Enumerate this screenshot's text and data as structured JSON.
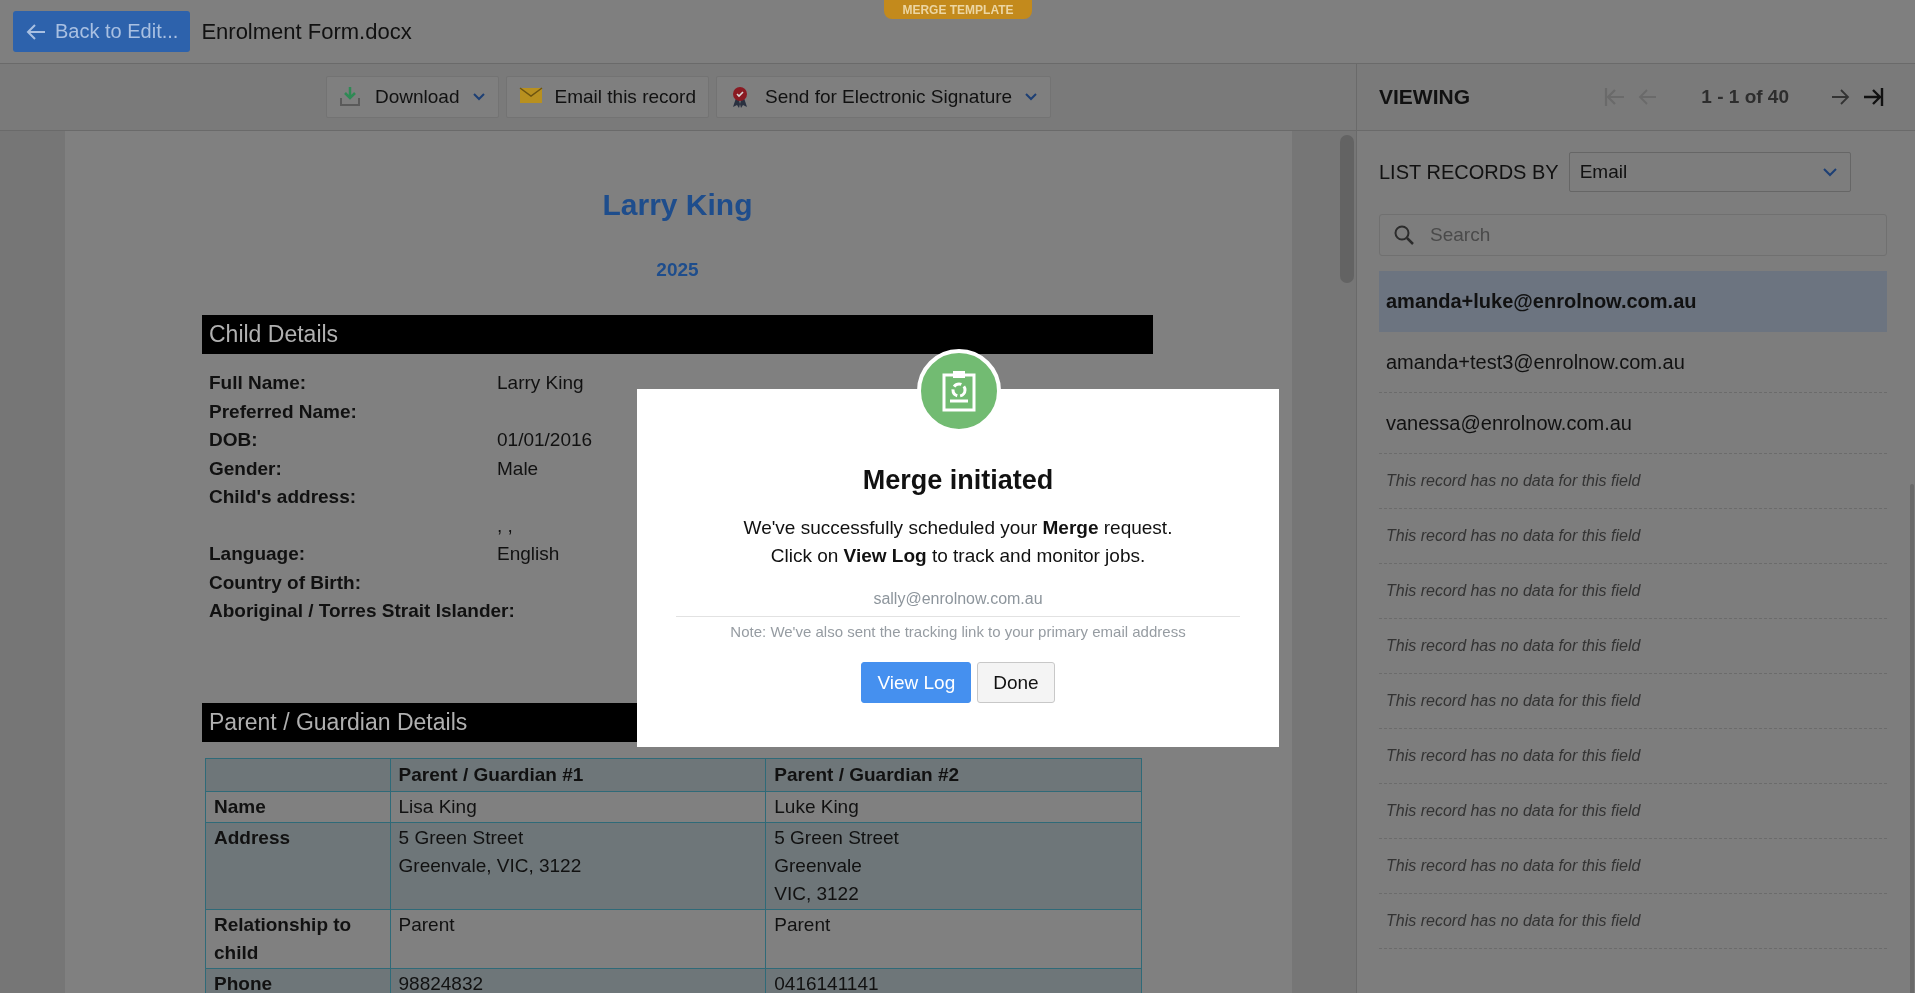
{
  "top_bar": {
    "back_button": "Back to Edit...",
    "file_name": "Enrolment Form.docx",
    "badge": "MERGE TEMPLATE"
  },
  "toolbar": [
    {
      "kind": "download",
      "label": "Download",
      "dropdown": true
    },
    {
      "kind": "email",
      "label": "Email this record",
      "dropdown": false
    },
    {
      "kind": "signature",
      "label": "Send for Electronic Signature",
      "dropdown": true
    }
  ],
  "document": {
    "title": "Larry King",
    "year": "2025",
    "sections": [
      {
        "kind": "fields",
        "heading": "Child Details",
        "fields": [
          {
            "label": "Full Name:",
            "value": "Larry King"
          },
          {
            "label": "Preferred Name:"
          },
          {
            "label": "DOB:",
            "value": "01/01/2016"
          },
          {
            "label": "Gender:",
            "value": "Male"
          },
          {
            "label": "Child's address:"
          },
          {
            "value": ", ,"
          },
          {
            "label": "Language:",
            "value": "English"
          },
          {
            "label": "Country of Birth:"
          },
          {
            "label": "Aboriginal / Torres Strait Islander:"
          }
        ]
      },
      {
        "kind": "table",
        "heading": "Parent / Guardian Details",
        "columns": [
          "Parent / Guardian #1",
          "Parent / Guardian #2"
        ],
        "rows": [
          {
            "label": "Name",
            "cells": [
              [
                "Lisa King"
              ],
              [
                "Luke King"
              ]
            ]
          },
          {
            "label": "Address",
            "cells": [
              [
                "5 Green Street",
                "Greenvale, VIC, 3122"
              ],
              [
                "5 Green Street",
                "Greenvale",
                "VIC, 3122"
              ]
            ]
          },
          {
            "label": "Relationship to child",
            "cells": [
              [
                "Parent"
              ],
              [
                "Parent"
              ]
            ]
          },
          {
            "label": "Phone",
            "cells": [
              [
                "98824832"
              ],
              [
                "0416141141"
              ]
            ]
          }
        ]
      }
    ]
  },
  "viewing_panel": {
    "title": "VIEWING",
    "pager": "1 - 1 of 40",
    "nav": [
      {
        "kind": "first",
        "disabled": true
      },
      {
        "kind": "prev",
        "disabled": true
      },
      {
        "kind": "next",
        "disabled": false
      },
      {
        "kind": "last",
        "disabled": false
      }
    ],
    "list_by": {
      "label": "LIST RECORDS BY",
      "value": "Email"
    },
    "search": {
      "placeholder": "Search"
    },
    "records": [
      {
        "kind": "value",
        "text": "amanda+luke@enrolnow.com.au",
        "selected": true
      },
      {
        "kind": "value",
        "text": "amanda+test3@enrolnow.com.au",
        "selected": false
      },
      {
        "kind": "value",
        "text": "vanessa@enrolnow.com.au",
        "selected": false
      },
      {
        "kind": "empty",
        "text": "This record has no data for this field",
        "selected": false
      },
      {
        "kind": "empty",
        "text": "This record has no data for this field",
        "selected": false
      },
      {
        "kind": "empty",
        "text": "This record has no data for this field",
        "selected": false
      },
      {
        "kind": "empty",
        "text": "This record has no data for this field",
        "selected": false
      },
      {
        "kind": "empty",
        "text": "This record has no data for this field",
        "selected": false
      },
      {
        "kind": "empty",
        "text": "This record has no data for this field",
        "selected": false
      },
      {
        "kind": "empty",
        "text": "This record has no data for this field",
        "selected": false
      },
      {
        "kind": "empty",
        "text": "This record has no data for this field",
        "selected": false
      },
      {
        "kind": "empty",
        "text": "This record has no data for this field",
        "selected": false
      }
    ]
  },
  "modal": {
    "title": "Merge initiated",
    "message_lines": [
      "We've successfully scheduled your **Merge** request.",
      "Click on **View Log** to track and monitor jobs."
    ],
    "email": "sally@enrolnow.com.au",
    "note": "Note: We've also sent the tracking link to your primary email address",
    "buttons": [
      {
        "kind": "primary",
        "label": "View Log"
      },
      {
        "kind": "secondary",
        "label": "Done"
      }
    ]
  }
}
